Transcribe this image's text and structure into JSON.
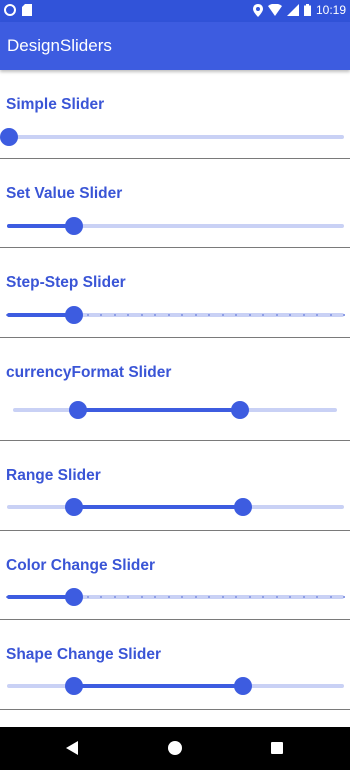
{
  "status_bar": {
    "time": "10:19",
    "icons": [
      "circle-notification-icon",
      "sd-card-icon",
      "location-icon",
      "wifi-icon",
      "signal-icon",
      "battery-icon"
    ]
  },
  "app_bar": {
    "title": "DesignSliders"
  },
  "colors": {
    "primary": "#3d5ce0",
    "status_bar": "#3153d9",
    "track_inactive": "#c9d1f5",
    "label": "#3a55d6"
  },
  "sliders": [
    {
      "label": "Simple Slider",
      "type": "single",
      "value": 0.0
    },
    {
      "label": "Set Value Slider",
      "type": "single",
      "value": 0.2
    },
    {
      "label": "Step-Step Slider",
      "type": "stepped",
      "value": 0.2,
      "steps": 25
    },
    {
      "label": "currencyFormat Slider",
      "type": "range",
      "start": 0.2,
      "end": 0.7
    },
    {
      "label": "Range Slider",
      "type": "range",
      "start": 0.2,
      "end": 0.7
    },
    {
      "label": "Color Change Slider",
      "type": "stepped",
      "value": 0.2,
      "steps": 25
    },
    {
      "label": "Shape Change Slider",
      "type": "range",
      "start": 0.2,
      "end": 0.7
    }
  ]
}
